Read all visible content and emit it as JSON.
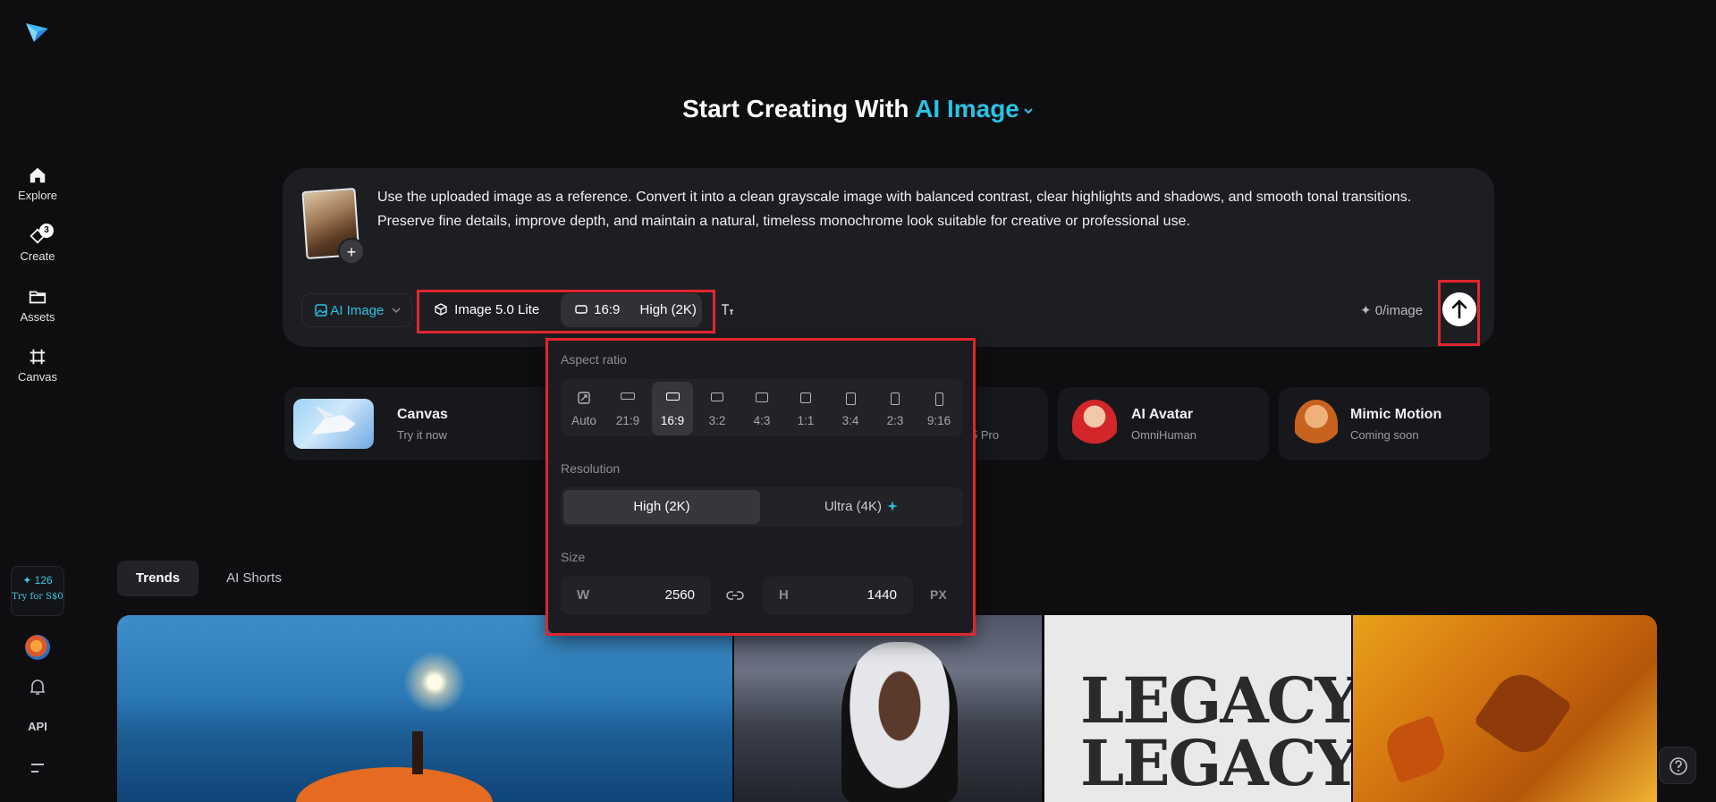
{
  "sidebar": {
    "items": [
      {
        "label": "Explore",
        "icon": "home-icon"
      },
      {
        "label": "Create",
        "icon": "create-icon",
        "badge": "3"
      },
      {
        "label": "Assets",
        "icon": "folder-icon"
      },
      {
        "label": "Canvas",
        "icon": "canvas-icon"
      }
    ],
    "credits": {
      "amount": "✦ 126",
      "offer": "Try for S$0"
    },
    "api_label": "API"
  },
  "heading": {
    "prefix": "Start Creating With",
    "mode": "AI Image"
  },
  "prompt": {
    "text": "Use the uploaded image as a reference. Convert it into a clean grayscale image with balanced contrast, clear highlights and shadows, and smooth tonal transitions. Preserve fine details, improve depth, and maintain a natural, timeless monochrome look suitable for creative or professional use."
  },
  "toolbar": {
    "mode_label": "AI Image",
    "model_label": "Image 5.0 Lite",
    "ratio_label": "16:9",
    "resolution_label": "High (2K)",
    "cost_label": "✦ 0/image"
  },
  "features": [
    {
      "title": "Canvas",
      "subtitle": "Try it now"
    },
    {
      "title": "",
      "subtitle": "5 Pro"
    },
    {
      "title": "AI Avatar",
      "subtitle": "OmniHuman"
    },
    {
      "title": "Mimic Motion",
      "subtitle": "Coming soon"
    }
  ],
  "popover": {
    "aspect_title": "Aspect ratio",
    "ratios": [
      "Auto",
      "21:9",
      "16:9",
      "3:2",
      "4:3",
      "1:1",
      "3:4",
      "2:3",
      "9:16"
    ],
    "selected_ratio": "16:9",
    "resolution_title": "Resolution",
    "resolutions": [
      "High (2K)",
      "Ultra (4K)"
    ],
    "selected_resolution": "High (2K)",
    "size_title": "Size",
    "width_key": "W",
    "width_value": "2560",
    "height_key": "H",
    "height_value": "1440",
    "unit": "PX"
  },
  "tabs": [
    {
      "label": "Trends",
      "active": true
    },
    {
      "label": "AI Shorts",
      "active": false
    }
  ],
  "gallery": {
    "legacy_text": "LEGACY"
  },
  "colors": {
    "accent": "#2bc2e5",
    "highlight": "#e0262e",
    "background": "#0e0e10"
  }
}
